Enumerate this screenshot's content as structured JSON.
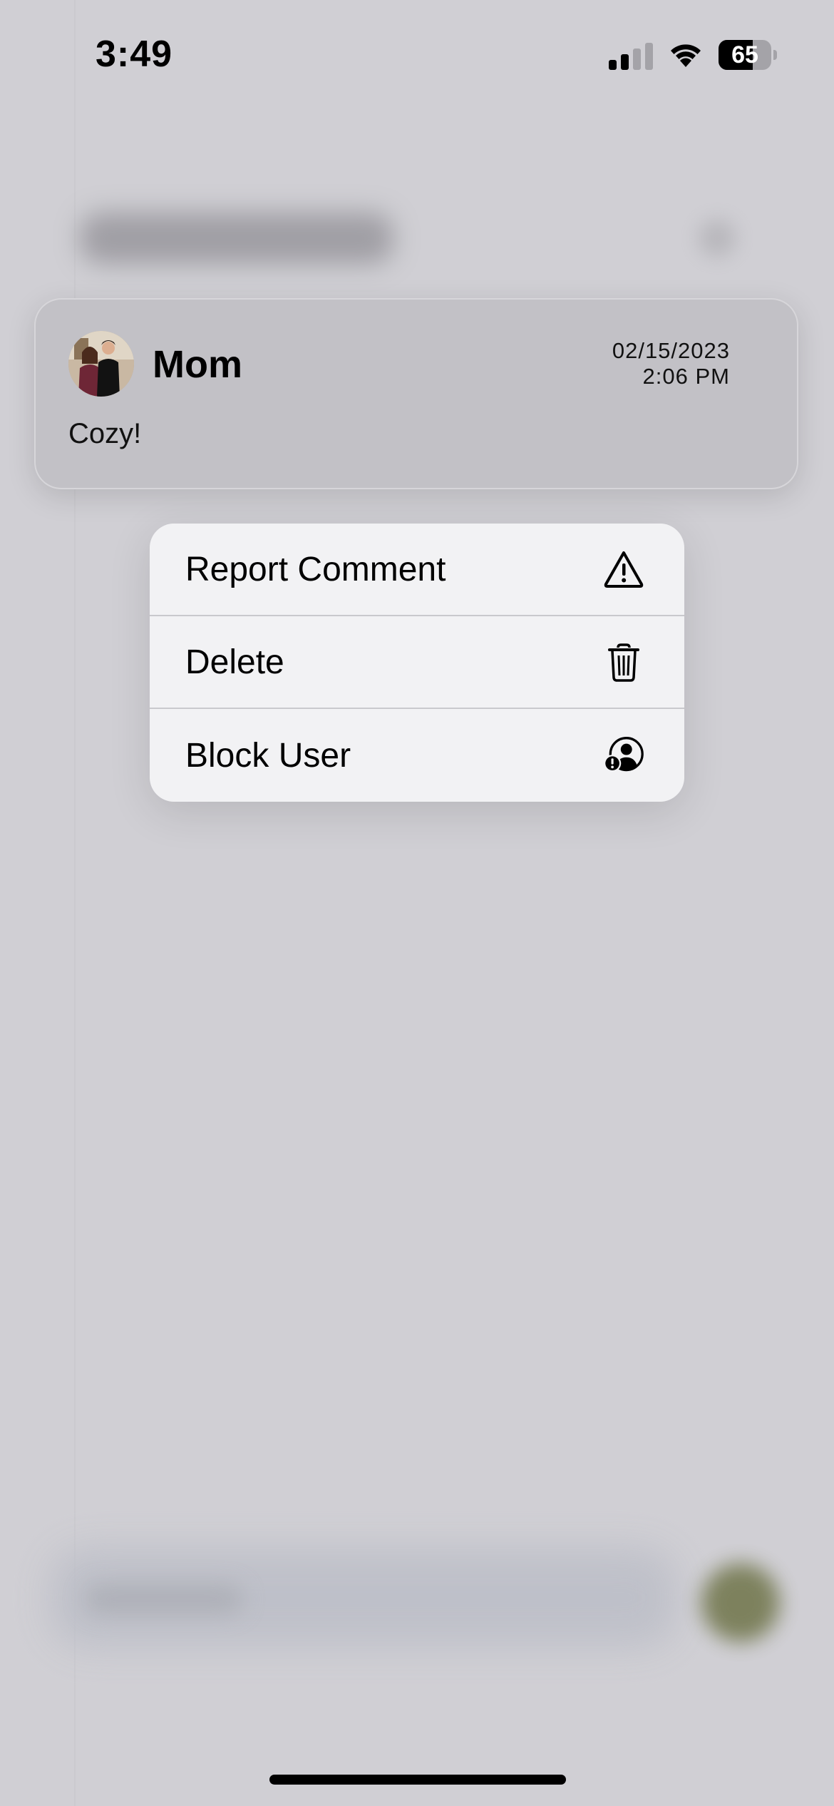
{
  "status_bar": {
    "time": "3:49",
    "battery_percent": "65",
    "battery_level": 0.65,
    "signal_bars_active": 2,
    "signal_bars_total": 4,
    "icons": [
      "cellular-signal-icon",
      "wifi-icon",
      "battery-icon"
    ]
  },
  "comment": {
    "author": "Mom",
    "date": "02/15/2023",
    "time": "2:06 PM",
    "text": "Cozy!",
    "avatar": "user-avatar-photo"
  },
  "context_menu": {
    "items": [
      {
        "label": "Report Comment",
        "icon": "warning-triangle-icon"
      },
      {
        "label": "Delete",
        "icon": "trash-icon"
      },
      {
        "label": "Block User",
        "icon": "block-user-icon"
      }
    ]
  },
  "colors": {
    "background_dim": "#d0cfd4",
    "card_background": "#c2c1c6",
    "menu_background": "#f2f2f4",
    "menu_separator": "#c9c9cd",
    "send_button_blurred": "#6f7449"
  }
}
